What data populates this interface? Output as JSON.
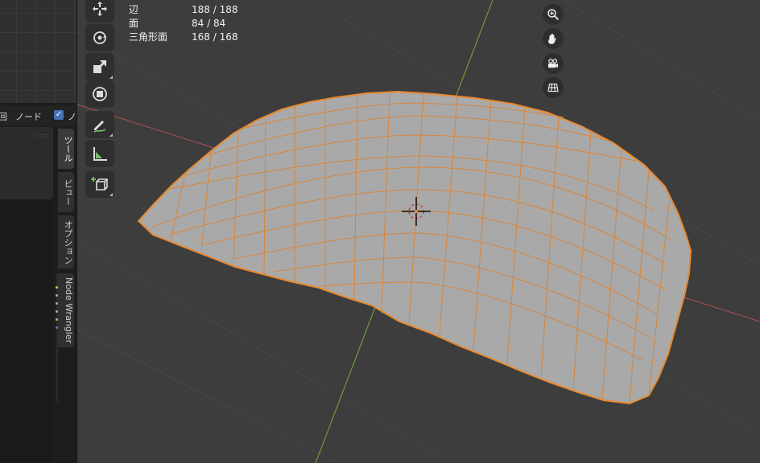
{
  "stats": {
    "edges_label": "辺",
    "edges_value": "188 / 188",
    "faces_label": "面",
    "faces_value": "84 / 84",
    "tris_label": "三角形面",
    "tris_value": "168 / 168"
  },
  "node_editor": {
    "header_cut_label": "回",
    "header_node_label": "ノード",
    "header_check_label": "ノ",
    "checkbox_checked": true
  },
  "side_tabs": [
    "ツール",
    "ビュー",
    "オプション",
    "Node Wrangler"
  ],
  "toolbar": [
    "move-icon",
    "rotate-icon",
    "scale-icon",
    "transform-icon",
    "annotate-icon",
    "measure-icon",
    "add-cube-icon"
  ],
  "navigation": [
    "zoom-icon",
    "pan-hand-icon",
    "camera-icon",
    "ortho-grid-icon"
  ],
  "colors": {
    "viewport_bg": "#3d3d3d",
    "mesh_fill": "#a9a9a9",
    "edge_selected": "#e8892e",
    "x_axis": "#b84d4d",
    "y_axis": "#6e9a3c"
  }
}
